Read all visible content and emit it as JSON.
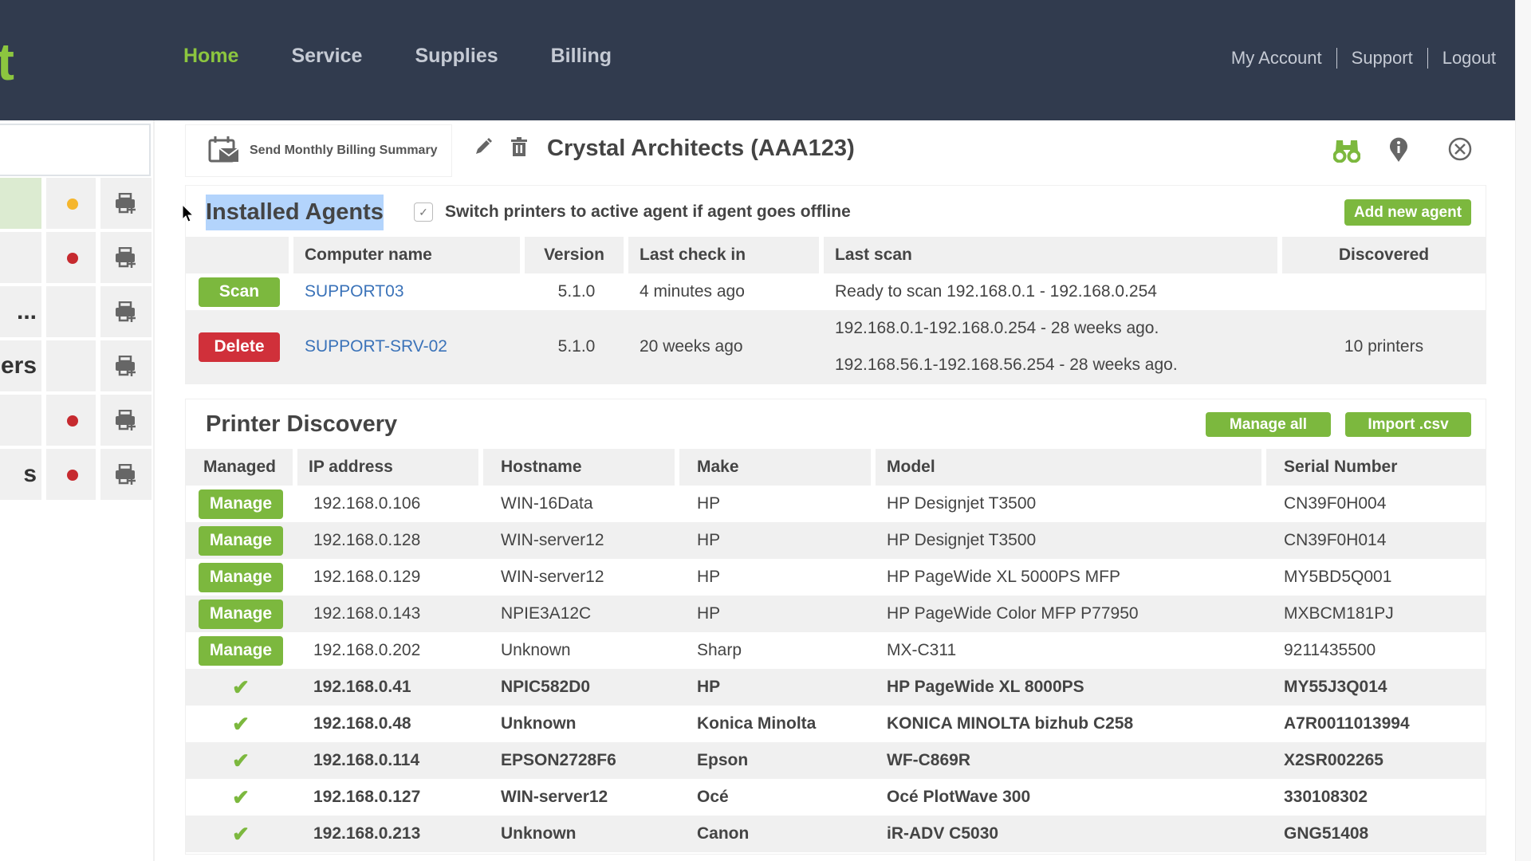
{
  "header": {
    "logo_fragment": "t",
    "nav": [
      {
        "label": "Home",
        "active": true
      },
      {
        "label": "Service",
        "active": false
      },
      {
        "label": "Supplies",
        "active": false
      },
      {
        "label": "Billing",
        "active": false
      }
    ],
    "utility_links": [
      "My Account",
      "Support",
      "Logout"
    ]
  },
  "colors": {
    "brand_green": "#8cc63f",
    "button_green": "#7cb83e",
    "danger_red": "#d0303a",
    "topbar": "#313b4e",
    "link_blue": "#3b73b9",
    "status_orange": "#f5b62d",
    "status_red": "#c62a2f"
  },
  "left_list": {
    "rows": [
      {
        "text_fragment": "",
        "selected": true,
        "status": "orange"
      },
      {
        "text_fragment": "",
        "selected": false,
        "status": "red"
      },
      {
        "text_fragment": "...",
        "selected": false,
        "status": "none"
      },
      {
        "text_fragment": "ers",
        "selected": false,
        "status": "none"
      },
      {
        "text_fragment": "",
        "selected": false,
        "status": "red"
      },
      {
        "text_fragment": "s",
        "selected": false,
        "status": "red"
      }
    ]
  },
  "customer": {
    "billing_button_label": "Send Monthly Billing Summary",
    "title": "Crystal Architects (AAA123)"
  },
  "installed_agents": {
    "title": "Installed Agents",
    "switch_checkbox_label": "Switch printers to active agent if agent goes offline",
    "switch_checked": true,
    "add_button_label": "Add new agent",
    "columns": [
      "",
      "Computer name",
      "Version",
      "Last check in",
      "Last scan",
      "Discovered"
    ],
    "rows": [
      {
        "action": "Scan",
        "computer_name": "SUPPORT03",
        "version": "5.1.0",
        "last_check_in": "4 minutes ago",
        "last_scan": [
          "Ready to scan 192.168.0.1 - 192.168.0.254"
        ],
        "discovered": ""
      },
      {
        "action": "Delete",
        "computer_name": "SUPPORT-SRV-02",
        "version": "5.1.0",
        "last_check_in": "20 weeks ago",
        "last_scan": [
          "192.168.0.1-192.168.0.254 - 28 weeks ago.",
          "192.168.56.1-192.168.56.254 - 28 weeks ago."
        ],
        "discovered": "10 printers"
      }
    ]
  },
  "printer_discovery": {
    "title": "Printer Discovery",
    "manage_all_label": "Manage all",
    "import_label": "Import .csv",
    "manage_label": "Manage",
    "columns": [
      "Managed",
      "IP address",
      "Hostname",
      "Make",
      "Model",
      "Serial Number"
    ],
    "rows": [
      {
        "managed": false,
        "ip": "192.168.0.106",
        "hostname": "WIN-16Data",
        "make": "HP",
        "model": "HP Designjet T3500",
        "serial": "CN39F0H004"
      },
      {
        "managed": false,
        "ip": "192.168.0.128",
        "hostname": "WIN-server12",
        "make": "HP",
        "model": "HP Designjet T3500",
        "serial": "CN39F0H014"
      },
      {
        "managed": false,
        "ip": "192.168.0.129",
        "hostname": "WIN-server12",
        "make": "HP",
        "model": "HP PageWide XL 5000PS MFP",
        "serial": "MY5BD5Q001"
      },
      {
        "managed": false,
        "ip": "192.168.0.143",
        "hostname": "NPIE3A12C",
        "make": "HP",
        "model": "HP PageWide Color MFP P77950",
        "serial": "MXBCM181PJ"
      },
      {
        "managed": false,
        "ip": "192.168.0.202",
        "hostname": "Unknown",
        "make": "Sharp",
        "model": "MX-C311",
        "serial": "9211435500"
      },
      {
        "managed": true,
        "ip": "192.168.0.41",
        "hostname": "NPIC582D0",
        "make": "HP",
        "model": "HP PageWide XL 8000PS",
        "serial": "MY55J3Q014"
      },
      {
        "managed": true,
        "ip": "192.168.0.48",
        "hostname": "Unknown",
        "make": "Konica Minolta",
        "model": "KONICA MINOLTA bizhub C258",
        "serial": "A7R0011013994"
      },
      {
        "managed": true,
        "ip": "192.168.0.114",
        "hostname": "EPSON2728F6",
        "make": "Epson",
        "model": "WF-C869R",
        "serial": "X2SR002265"
      },
      {
        "managed": true,
        "ip": "192.168.0.127",
        "hostname": "WIN-server12",
        "make": "Océ",
        "model": "Océ PlotWave 300",
        "serial": "330108302"
      },
      {
        "managed": true,
        "ip": "192.168.0.213",
        "hostname": "Unknown",
        "make": "Canon",
        "model": "iR-ADV C5030",
        "serial": "GNG51408"
      }
    ]
  }
}
